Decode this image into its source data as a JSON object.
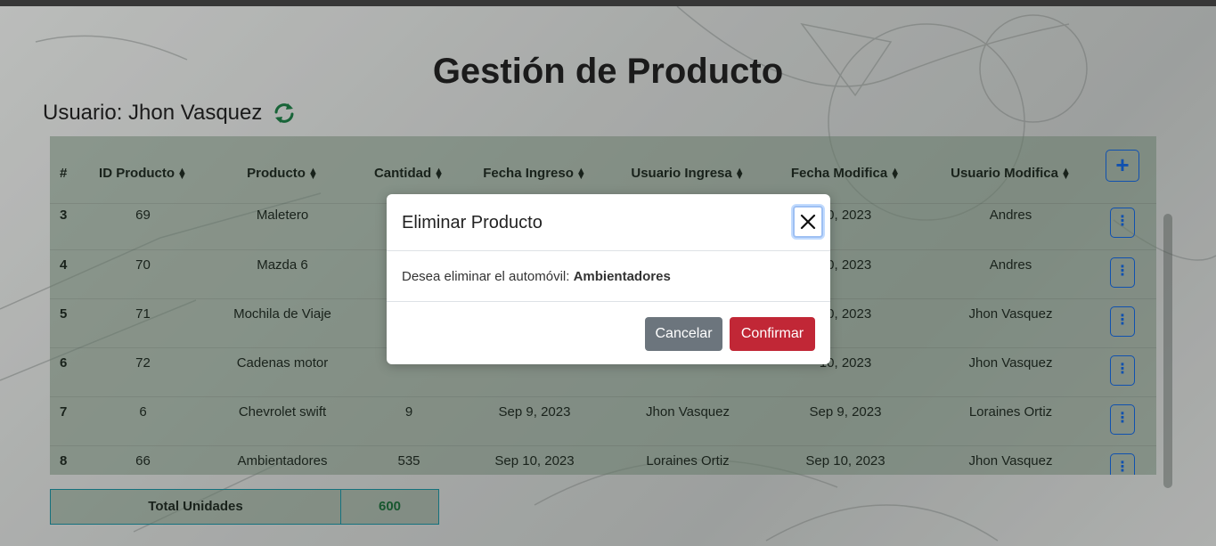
{
  "page": {
    "title": "Gestión de Producto",
    "user_label": "Usuario: Jhon Vasquez",
    "refresh_icon": "refresh-icon",
    "accent_color": "#1463d6"
  },
  "table": {
    "headers": [
      "#",
      "ID Producto",
      "Producto",
      "Cantidad",
      "Fecha Ingreso",
      "Usuario Ingresa",
      "Fecha Modifica",
      "Usuario Modifica"
    ],
    "rows": [
      {
        "num": "3",
        "id": "69",
        "producto": "Maletero",
        "cantidad": "",
        "fecha_ingreso": "",
        "usuario_ingresa": "",
        "fecha_modifica": "10, 2023",
        "usuario_modifica": "Andres"
      },
      {
        "num": "4",
        "id": "70",
        "producto": "Mazda 6",
        "cantidad": "",
        "fecha_ingreso": "",
        "usuario_ingresa": "",
        "fecha_modifica": "10, 2023",
        "usuario_modifica": "Andres"
      },
      {
        "num": "5",
        "id": "71",
        "producto": "Mochila de Viaje",
        "cantidad": "",
        "fecha_ingreso": "",
        "usuario_ingresa": "",
        "fecha_modifica": "10, 2023",
        "usuario_modifica": "Jhon Vasquez"
      },
      {
        "num": "6",
        "id": "72",
        "producto": "Cadenas motor",
        "cantidad": "",
        "fecha_ingreso": "",
        "usuario_ingresa": "",
        "fecha_modifica": "10, 2023",
        "usuario_modifica": "Jhon Vasquez"
      },
      {
        "num": "7",
        "id": "6",
        "producto": "Chevrolet swift",
        "cantidad": "9",
        "fecha_ingreso": "Sep 9, 2023",
        "usuario_ingresa": "Jhon Vasquez",
        "fecha_modifica": "Sep 9, 2023",
        "usuario_modifica": "Loraines Ortiz"
      },
      {
        "num": "8",
        "id": "66",
        "producto": "Ambientadores",
        "cantidad": "535",
        "fecha_ingreso": "Sep 10, 2023",
        "usuario_ingresa": "Loraines Ortiz",
        "fecha_modifica": "Sep 10, 2023",
        "usuario_modifica": "Jhon Vasquez"
      }
    ],
    "add_button_label": "+",
    "row_action_label": "⋮"
  },
  "totals": {
    "label": "Total Unidades",
    "value": "600"
  },
  "modal": {
    "title": "Eliminar Producto",
    "message_prefix": "Desea eliminar el automóvil:",
    "message_item": "Ambientadores",
    "cancel_label": "Cancelar",
    "confirm_label": "Confirmar",
    "cancel_color": "#6c757d",
    "confirm_color": "#c12736"
  }
}
